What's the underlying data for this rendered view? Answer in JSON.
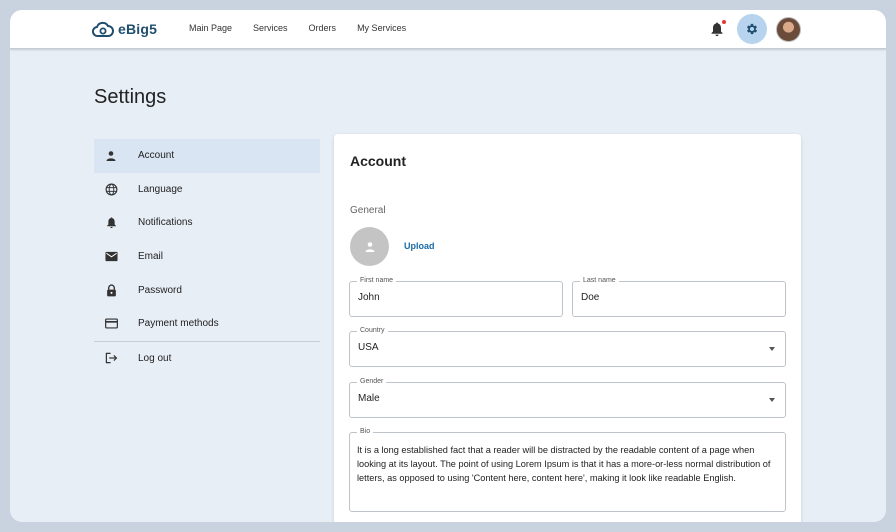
{
  "header": {
    "brand": "eBig5",
    "nav": [
      "Main Page",
      "Services",
      "Orders",
      "My Services"
    ]
  },
  "page_title": "Settings",
  "sidebar": {
    "items": [
      {
        "label": "Account",
        "icon": "person-icon",
        "active": true
      },
      {
        "label": "Language",
        "icon": "globe-icon"
      },
      {
        "label": "Notifications",
        "icon": "bell-icon"
      },
      {
        "label": "Email",
        "icon": "mail-icon"
      },
      {
        "label": "Password",
        "icon": "lock-icon"
      },
      {
        "label": "Payment methods",
        "icon": "credit-card-icon"
      },
      {
        "label": "Log out",
        "icon": "logout-icon"
      }
    ]
  },
  "account": {
    "title": "Account",
    "section": "General",
    "upload_label": "Upload",
    "first_name": {
      "label": "First name",
      "value": "John"
    },
    "last_name": {
      "label": "Last name",
      "value": "Doe"
    },
    "country": {
      "label": "Country",
      "value": "USA"
    },
    "gender": {
      "label": "Gender",
      "value": "Male"
    },
    "bio": {
      "label": "Bio",
      "value": "It is a long established fact that a reader will be distracted by the readable content of a page when looking at its layout. The point of using Lorem Ipsum is that it has a more-or-less normal distribution of letters, as opposed to using 'Content here, content here', making it look like readable English."
    }
  },
  "colors": {
    "accent": "#1a6aa6",
    "brand": "#1f4e6e",
    "active_bg": "#d9e5f2",
    "page_bg": "#e8eef6",
    "notification_dot": "#e53935"
  }
}
